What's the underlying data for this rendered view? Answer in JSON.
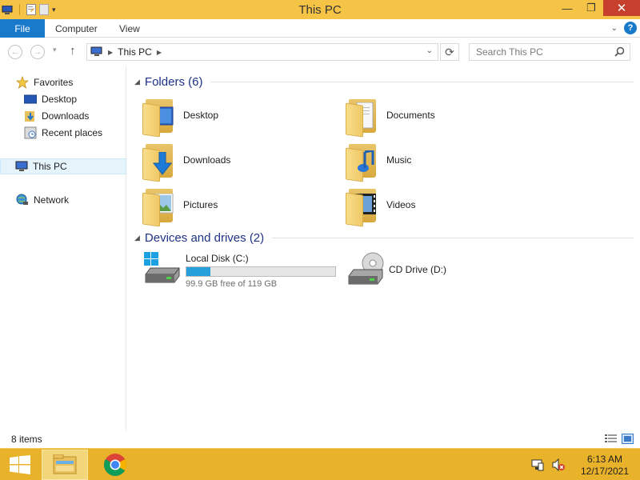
{
  "window": {
    "title": "This PC"
  },
  "title_buttons": {
    "minimize": "—",
    "maximize": "❐",
    "close": "✕"
  },
  "ribbon": {
    "file_label": "File",
    "tabs": [
      "Computer",
      "View"
    ],
    "help_label": "?"
  },
  "address_bar": {
    "crumbs": [
      "This PC"
    ],
    "search_placeholder": "Search This PC"
  },
  "sidebar": {
    "favorites_label": "Favorites",
    "favorites": [
      "Desktop",
      "Downloads",
      "Recent places"
    ],
    "this_pc_label": "This PC",
    "network_label": "Network"
  },
  "folders_group": {
    "title": "Folders (6)",
    "items": [
      "Desktop",
      "Documents",
      "Downloads",
      "Music",
      "Pictures",
      "Videos"
    ]
  },
  "drives_group": {
    "title": "Devices and drives (2)",
    "drives": [
      {
        "name": "Local Disk (C:)",
        "free_text": "99.9 GB free of 119 GB",
        "used_fraction": 0.16
      },
      {
        "name": "CD Drive (D:)"
      }
    ]
  },
  "status_bar": {
    "item_count": "8 items"
  },
  "taskbar": {
    "time": "6:13 AM",
    "date": "12/17/2021"
  },
  "colors": {
    "titlebar": "#f5c446",
    "taskbar": "#e8b22a",
    "accent": "#1979ca",
    "drive_fill": "#26a0da"
  }
}
